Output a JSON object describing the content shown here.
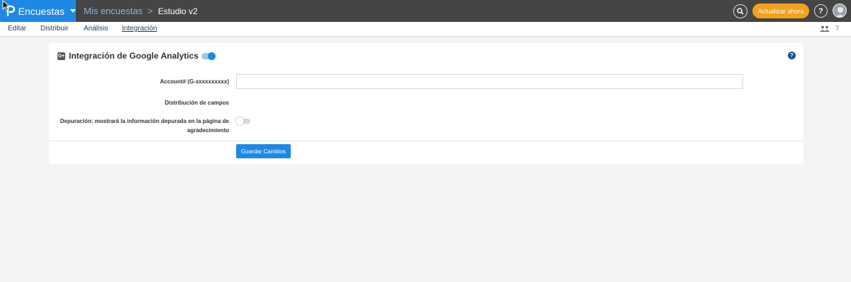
{
  "brand": {
    "name": "Encuestas",
    "color": "#1e88e5"
  },
  "breadcrumb": {
    "parent": "Mis encuestas",
    "separator": ">",
    "current": "Estudio v2"
  },
  "header": {
    "upgrade_label": "Actualizar ahora",
    "help_label": "?",
    "search_icon": "search-icon",
    "upgrade_color": "#f5a01a"
  },
  "subnav": {
    "items": [
      {
        "label": "Editar"
      },
      {
        "label": "Distribuir"
      },
      {
        "label": "Análisis"
      },
      {
        "label": "Integración",
        "active": true
      }
    ],
    "collaborators_count": "7"
  },
  "panel": {
    "icon_text": "G+",
    "title": "Integración de Google Analytics",
    "enabled": true,
    "help_label": "?",
    "fields": {
      "account_label": "Account# (G-xxxxxxxxxx)",
      "account_value": "",
      "mapping_label": "Distribución de campos",
      "debug_label_line1": "Depuración: mostrará la información depurada en la página de",
      "debug_label_line2": "agradecimiento",
      "debug_enabled": false
    },
    "save_label": "Guardar Cambios"
  }
}
